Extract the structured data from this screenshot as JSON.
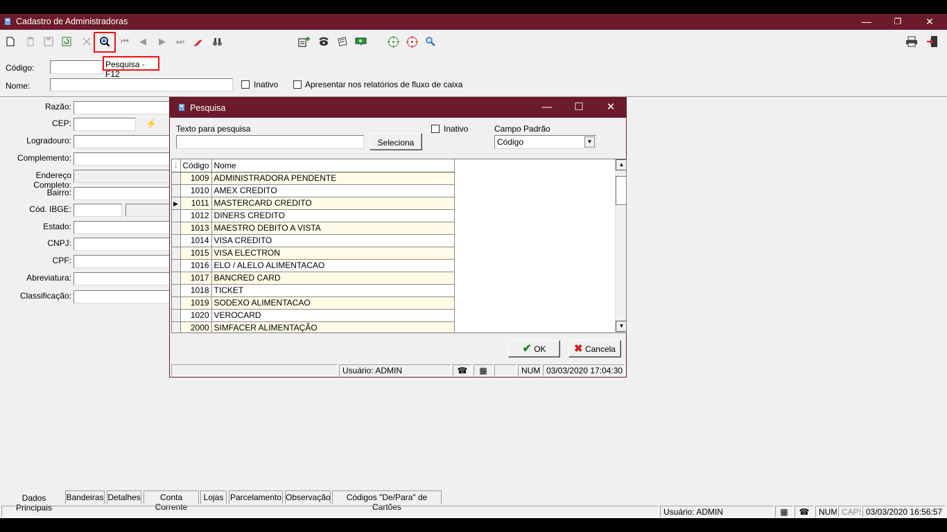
{
  "window": {
    "title": "Cadastro de Administradoras",
    "controls": {
      "minimize": "—",
      "restore": "❐",
      "close": "✕"
    }
  },
  "toolbar": {
    "tooltip": "Pesquisa - F12"
  },
  "form": {
    "codigo_label": "Código:",
    "nome_label": "Nome:",
    "inativo_label": "Inativo",
    "fluxo_label": "Apresentar nos relatórios de fluxo de caixa",
    "fields": [
      {
        "name": "razao",
        "label": "Razão:"
      },
      {
        "name": "cep",
        "label": "CEP:"
      },
      {
        "name": "logradouro",
        "label": "Logradouro:"
      },
      {
        "name": "complemento",
        "label": "Complemento:"
      },
      {
        "name": "endereco-completo",
        "label": "Endereço Completo:"
      },
      {
        "name": "bairro",
        "label": "Bairro:"
      },
      {
        "name": "cod-ibge",
        "label": "Cód. IBGE:"
      },
      {
        "name": "estado",
        "label": "Estado:"
      },
      {
        "name": "cnpj",
        "label": "CNPJ:"
      },
      {
        "name": "cpf",
        "label": "CPF:"
      },
      {
        "name": "abreviatura",
        "label": "Abreviatura:"
      },
      {
        "name": "classificacao",
        "label": "Classificação:"
      }
    ]
  },
  "tabs": [
    "Dados Principais",
    "Bandeiras",
    "Detalhes",
    "Conta Corrente",
    "Lojas",
    "Parcelamento",
    "Observação",
    "Códigos \"De/Para\" de Cartões"
  ],
  "statusbar": {
    "usuario": "Usuário: ADMIN",
    "num": "NUM",
    "caps": "CAPS",
    "datetime": "03/03/2020 16:56:57"
  },
  "dialog": {
    "title": "Pesquisa",
    "search_label": "Texto para pesquisa",
    "search_value": "",
    "seleciona_label": "Seleciona",
    "inativo_label": "Inativo",
    "campo_padrao_label": "Campo Padrão",
    "campo_padrao_value": "Código",
    "columns": [
      "Código",
      "Nome"
    ],
    "rows": [
      {
        "codigo": "1009",
        "nome": "ADMINISTRADORA PENDENTE"
      },
      {
        "codigo": "1010",
        "nome": "AMEX CREDITO"
      },
      {
        "codigo": "1011",
        "nome": "MASTERCARD CREDITO"
      },
      {
        "codigo": "1012",
        "nome": "DINERS CREDITO"
      },
      {
        "codigo": "1013",
        "nome": "MAESTRO DEBITO A VISTA"
      },
      {
        "codigo": "1014",
        "nome": "VISA CREDITO"
      },
      {
        "codigo": "1015",
        "nome": "VISA ELECTRON"
      },
      {
        "codigo": "1016",
        "nome": "ELO / ALELO ALIMENTACAO"
      },
      {
        "codigo": "1017",
        "nome": "BANCRED CARD"
      },
      {
        "codigo": "1018",
        "nome": "TICKET"
      },
      {
        "codigo": "1019",
        "nome": "SODEXO ALIMENTACAO"
      },
      {
        "codigo": "1020",
        "nome": "VEROCARD"
      },
      {
        "codigo": "2000",
        "nome": "SIMFACER ALIMENTAÇÃO"
      }
    ],
    "selected_row": 2,
    "ok_label": "OK",
    "cancel_label": "Cancela",
    "status": {
      "usuario": "Usuário: ADMIN",
      "num": "NUM",
      "datetime": "03/03/2020 17:04:30"
    }
  },
  "colors": {
    "titlebar": "#6b1b2b",
    "highlight": "#e11111",
    "row_alt": "#fffbe6"
  }
}
